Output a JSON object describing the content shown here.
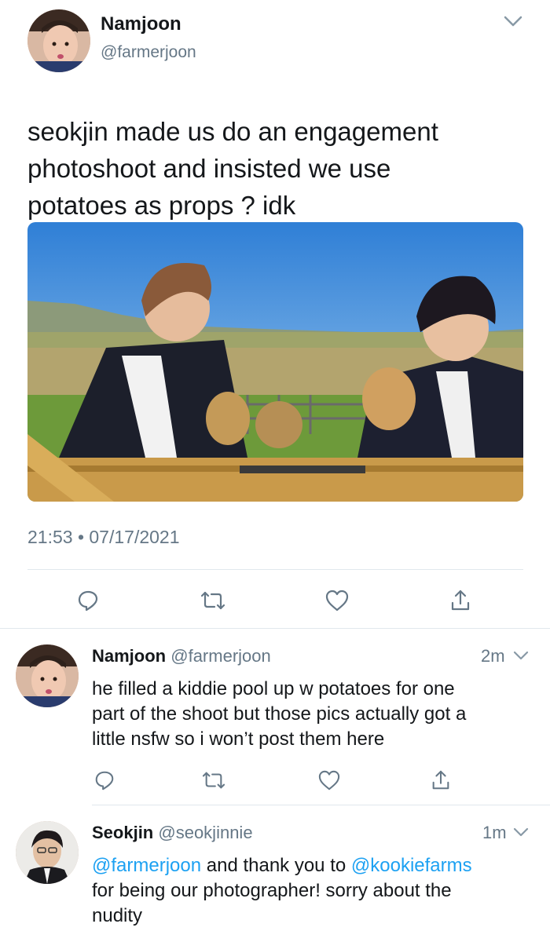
{
  "main_tweet": {
    "display_name": "Namjoon",
    "handle": "@farmerjoon",
    "text_lines": [
      "seokjin made us do an engagement",
      "photoshoot and insisted we use",
      "potatoes as props ? idk"
    ],
    "timestamp": "21:53 • 07/17/2021"
  },
  "replies": [
    {
      "display_name": "Namjoon",
      "handle": "@farmerjoon",
      "time": "2m",
      "text_lines": [
        "he filled a kiddie pool up w potatoes for one",
        "part of the shoot but those pics actually got a",
        "little nsfw so i won’t post them here"
      ]
    },
    {
      "display_name": "Seokjin",
      "handle": "@seokjinnie",
      "time": "1m",
      "mention1": "@farmerjoon",
      "line1_mid": " and thank you to ",
      "mention2": "@kookiefarms",
      "line2": "for being our photographer! sorry about the",
      "line3": "nudity"
    }
  ],
  "icons": [
    "chevron-down-icon",
    "reply-icon",
    "retweet-icon",
    "like-icon",
    "share-icon"
  ],
  "colors": {
    "link": "#1da1f2",
    "muted": "#657786",
    "icon": "#657786",
    "divider": "#e1e8ed"
  }
}
